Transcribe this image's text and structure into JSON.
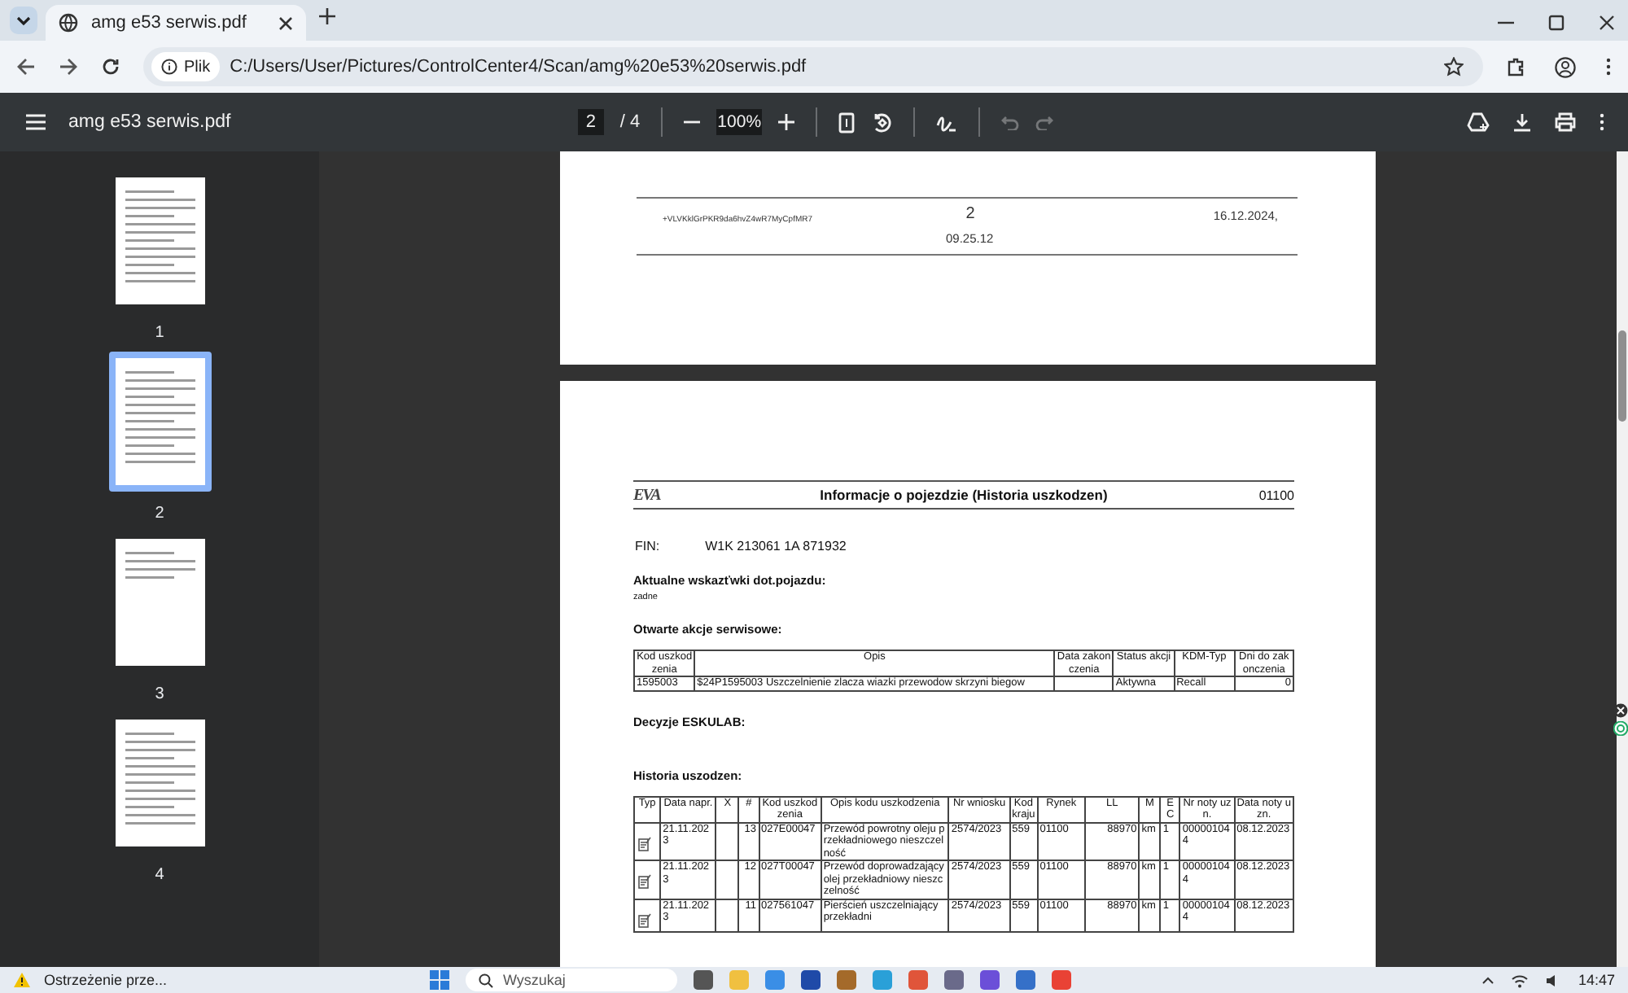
{
  "browser": {
    "tabs": [
      {
        "title": "amg e53 serwis.pdf",
        "selected": true
      }
    ],
    "address": {
      "scheme_label": "Plik",
      "url": "C:/Users/User/Pictures/ControlCenter4/Scan/amg%20e53%20serwis.pdf"
    }
  },
  "viewer": {
    "title": "amg e53 serwis.pdf",
    "page_input": "2",
    "page_total": "/ 4",
    "zoom": "100%",
    "undo": {
      "disabled": true
    },
    "redo": {
      "disabled": true
    }
  },
  "thumbnails": [
    {
      "label": "1",
      "selected": false
    },
    {
      "label": "2",
      "selected": true
    },
    {
      "label": "3",
      "selected": false
    },
    {
      "label": "4",
      "selected": false
    }
  ],
  "document": {
    "previous_page_footer": {
      "code": "+VLVKklGrPKR9da6hvZ4wR7MyCpfMR7",
      "page": "2",
      "date": "16.12.2024,",
      "time": "09.25.12"
    },
    "header": {
      "logo": "EVA",
      "title": "Informacje o pojezdzie (Historia uszkodzen)",
      "code": "01100"
    },
    "fin_label": "FIN:",
    "fin": "W1K 213061 1A 871932",
    "notes_heading": "Aktualne wskazťwki dot.pojazdu:",
    "notes": "zadne",
    "open_actions_heading": "Otwarte akcje serwisowe:",
    "open_actions_table": {
      "columns": [
        "Kod uszkodzenia",
        "Opis",
        "Data zakonczenia",
        "Status akcji",
        "KDM-Typ",
        "Dni do zakonczenia"
      ],
      "rows": [
        [
          "1595003",
          "$24P1595003 Uszczelnienie zlacza wiazki przewodow skrzyni biegow",
          "",
          "Aktywna",
          "Recall",
          "0"
        ]
      ]
    },
    "decisions_heading": "Decyzje ESKULAB:",
    "history_heading": "Historia uszodzen:",
    "history_table": {
      "columns": [
        "Typ",
        "Data napr.",
        "X",
        "#",
        "Kod uszkodzenia",
        "Opis kodu uszkodzenia",
        "Nr wniosku",
        "Kod kraju",
        "Rynek",
        "LL",
        "M",
        "E C",
        "Nr noty uzn.",
        "Data noty uzn."
      ],
      "rows": [
        [
          "",
          "21.11.2023",
          "",
          "13",
          "027E00047",
          "Przewód powrotny oleju przekładniowego nieszczelność",
          "2574/2023",
          "559",
          "01100",
          "88970",
          "km",
          "1",
          "000001044",
          "08.12.2023"
        ],
        [
          "",
          "21.11.2023",
          "",
          "12",
          "027T00047",
          "Przewód doprowadzający olej przekładniowy nieszczelność",
          "2574/2023",
          "559",
          "01100",
          "88970",
          "km",
          "1",
          "000001044",
          "08.12.2023"
        ],
        [
          "",
          "21.11.2023",
          "",
          "11",
          "027561047",
          "Pierścień uszczelniający przekładni",
          "2574/2023",
          "559",
          "01100",
          "88970",
          "km",
          "1",
          "000001044",
          "08.12.2023"
        ]
      ]
    }
  },
  "taskbar": {
    "notification": "Ostrzeżenie prze...",
    "search_placeholder": "Wyszukaj",
    "time": "14:47"
  }
}
